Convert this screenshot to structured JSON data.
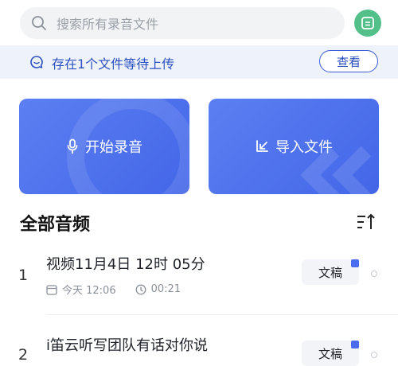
{
  "search": {
    "placeholder": "搜索所有录音文件"
  },
  "notice": {
    "text": "存在1个文件等待上传",
    "button": "查看"
  },
  "actions": {
    "record_label": "开始录音",
    "import_label": "导入文件"
  },
  "section": {
    "title": "全部音频"
  },
  "items": [
    {
      "index": "1",
      "title": "视频11月4日 12时 05分",
      "date": "今天 12:06",
      "duration": "00:21",
      "doc_label": "文稿"
    },
    {
      "index": "2",
      "title": "i笛云听写团队有话对你说",
      "doc_label": "文稿"
    }
  ],
  "colors": {
    "accent": "#4a6cf0",
    "notice_bg": "#eef3fb",
    "avatar": "#53c08a"
  }
}
